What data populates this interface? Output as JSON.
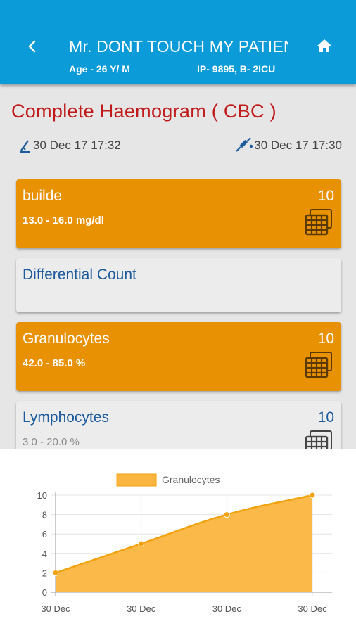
{
  "header": {
    "patient_name": "Mr. DONT TOUCH MY PATIENT",
    "age": "Age - 26 Y/ M",
    "ip": "IP- 9895, B- 2ICU",
    "back_icon": "chevron-left-icon",
    "home_icon": "home-icon"
  },
  "test": {
    "title": "Complete Haemogram ( CBC )",
    "collected_time": "30 Dec 17 17:32",
    "reported_time": "30 Dec 17 17:30"
  },
  "results": [
    {
      "name": "builde",
      "range": "13.0 - 16.0 mg/dl",
      "value": "10",
      "style": "orange"
    },
    {
      "name": "Differential Count",
      "range": "",
      "value": "",
      "style": "plain"
    },
    {
      "name": "Granulocytes",
      "range": "42.0 - 85.0 %",
      "value": "10",
      "style": "orange"
    },
    {
      "name": "Lymphocytes",
      "range": "3.0 - 20.0 %",
      "value": "10",
      "style": "plain"
    }
  ],
  "colors": {
    "appbar": "#0a9bd8",
    "accent_orange": "#e89102",
    "title_red": "#c11a1a",
    "link_blue": "#1c5a9c",
    "chart_fill": "#fbb540",
    "chart_line": "#f2a20d"
  },
  "chart_data": {
    "type": "area",
    "legend": "Granulocytes",
    "legend_position": "top",
    "x": [
      "30 Dec",
      "30 Dec",
      "30 Dec",
      "30 Dec"
    ],
    "values": [
      2,
      5,
      8,
      10
    ],
    "ylim": [
      0,
      10
    ],
    "yticks": [
      0,
      2,
      4,
      6,
      8,
      10
    ],
    "grid": true
  }
}
